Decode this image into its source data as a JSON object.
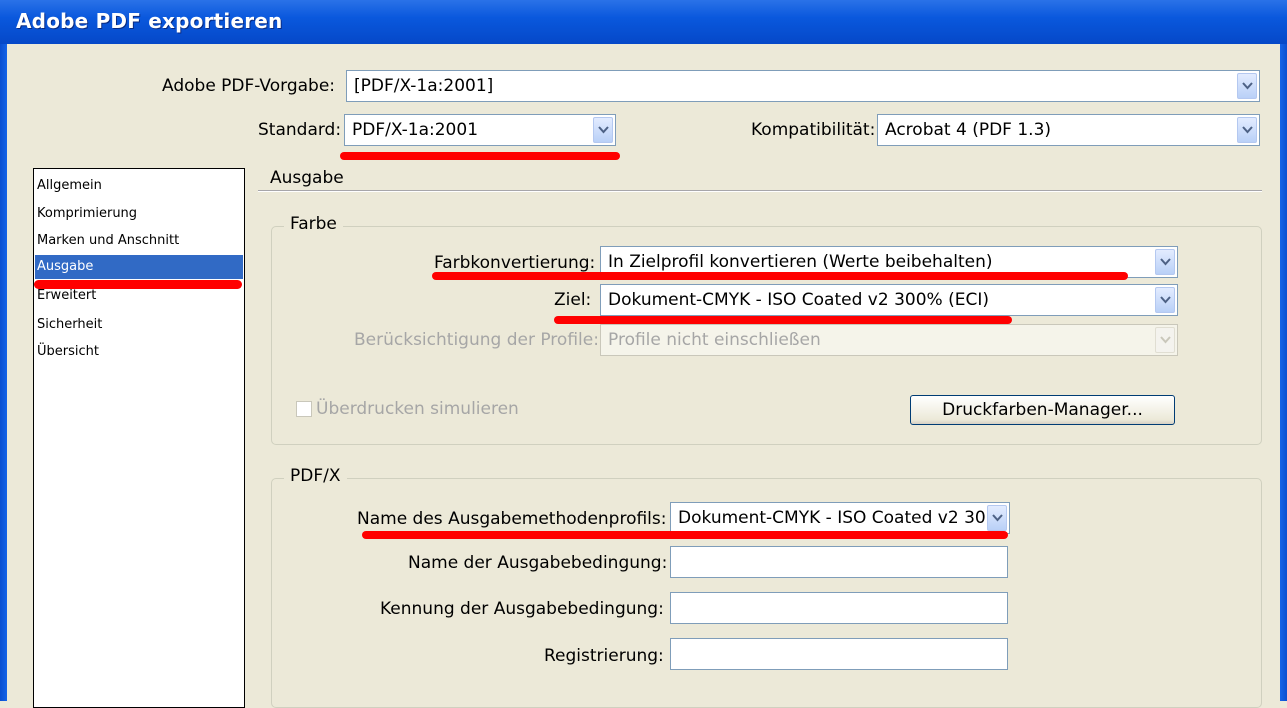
{
  "window": {
    "title": "Adobe PDF exportieren"
  },
  "preset": {
    "label": "Adobe PDF-Vorgabe:",
    "value": "[PDF/X-1a:2001]"
  },
  "standard": {
    "label": "Standard:",
    "value": "PDF/X-1a:2001"
  },
  "compat": {
    "label": "Kompatibilität:",
    "value": "Acrobat 4 (PDF 1.3)"
  },
  "sidebar": {
    "items": [
      {
        "label": "Allgemein"
      },
      {
        "label": "Komprimierung"
      },
      {
        "label": "Marken und Anschnitt"
      },
      {
        "label": "Ausgabe"
      },
      {
        "label": "Erweitert"
      },
      {
        "label": "Sicherheit"
      },
      {
        "label": "Übersicht"
      }
    ]
  },
  "section": {
    "title": "Ausgabe"
  },
  "color": {
    "legend": "Farbe",
    "conversion": {
      "label": "Farbkonvertierung:",
      "value": "In Zielprofil konvertieren (Werte beibehalten)"
    },
    "target": {
      "label": "Ziel:",
      "value": "Dokument-CMYK - ISO Coated v2 300% (ECI)"
    },
    "profiles": {
      "label": "Berücksichtigung der Profile:",
      "value": "Profile nicht einschließen"
    },
    "simulate": {
      "label": "Überdrucken simulieren",
      "checked": false
    },
    "ink_manager_label": "Druckfarben-Manager..."
  },
  "pdfx": {
    "legend": "PDF/X",
    "profile": {
      "label": "Name des Ausgabemethodenprofils:",
      "value": "Dokument-CMYK - ISO Coated v2 30"
    },
    "condition_name": {
      "label": "Name der Ausgabebedingung:",
      "value": ""
    },
    "condition_id": {
      "label": "Kennung der Ausgabebedingung:",
      "value": ""
    },
    "registry": {
      "label": "Registrierung:",
      "value": ""
    }
  },
  "colors": {
    "titlebar": "#0a58dd",
    "selection": "#316ac5",
    "annotation": "#ff0000",
    "dialog_bg": "#ece9d8"
  }
}
